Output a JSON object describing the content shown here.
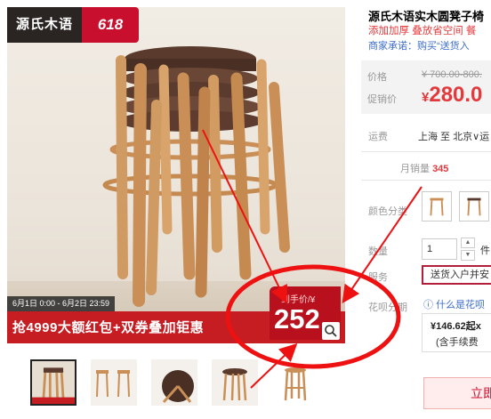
{
  "brand_badge": {
    "name": "源氏木语",
    "event": "618"
  },
  "promo": {
    "date_range": "6月1日 0:00 - 6月2日 23:59",
    "banner_text": "抢4999大额红包+双券叠加钜惠",
    "price_label": "到手价/¥",
    "price_value": "252"
  },
  "product": {
    "title": "源氏木语实木圆凳子椅",
    "subtitle": "添加加厚 叠放省空间 餐",
    "promise": "商家承诺：购买“送货入"
  },
  "pricing": {
    "list_label": "价格",
    "list_price": "¥ 700.00-800.",
    "sale_label": "促销价",
    "sale_currency": "¥",
    "sale_price": "280.0"
  },
  "shipping": {
    "label": "运费",
    "route": "上海 至 北京∨运"
  },
  "sales": {
    "label": "月销量",
    "count": "345"
  },
  "options": {
    "color_label": "颜色分类",
    "quantity_label": "数量",
    "quantity_value": "1",
    "quantity_unit": "件",
    "service_label": "服务",
    "service_option": "送货入户并安",
    "installment_label": "花呗分期",
    "installment_link": "什么是花呗",
    "installment_amount": "¥146.62起x",
    "installment_fee": "(含手续费"
  },
  "actions": {
    "buy_now": "立即"
  },
  "colors": {
    "accent_red": "#c8102e",
    "price_red": "#e4393c",
    "link_blue": "#3c6ccc",
    "wood": "#c98f56",
    "annotation_red": "#ee1111"
  },
  "icons": [
    "zoom-icon",
    "info-circle-icon",
    "arrow-up-icon",
    "arrow-down-icon"
  ]
}
